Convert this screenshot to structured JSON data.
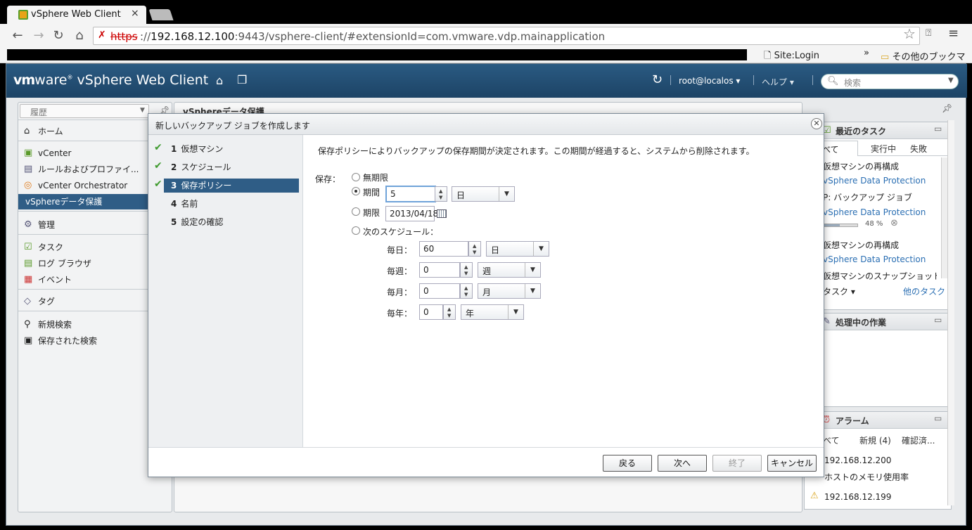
{
  "browser": {
    "tab_title": "vSphere Web Client",
    "tab_close": "×",
    "url_scheme": "https",
    "url_sep": "://",
    "url_host": "192.168.12.100",
    "url_path": ":9443/vsphere-client/#extensionId=com.vmware.vdp.mainapplication",
    "bookmarks": {
      "login": "Site:Login",
      "more": "»",
      "other": "その他のブックマーク"
    }
  },
  "app": {
    "brand_vm": "vm",
    "brand_ware": "ware",
    "brand_product": " vSphere Web Client",
    "user": "root@localos ▾",
    "help": "ヘルプ ▾",
    "search_placeholder": "検索"
  },
  "nav": {
    "history": "履歴",
    "items": {
      "home": "ホーム",
      "vcenter": "vCenter",
      "rules": "ルールおよびプロファイ...",
      "orchestrator": "vCenter Orchestrator",
      "vdp": "vSphereデータ保護",
      "admin": "管理",
      "tasks": "タスク",
      "log": "ログ ブラウザ",
      "events": "イベント",
      "tags": "タグ",
      "new_search": "新規検索",
      "saved_search": "保存された検索"
    }
  },
  "center": {
    "title": "vSphereデータ保護"
  },
  "right": {
    "recent_tasks": "最近のタスク",
    "tabs": {
      "all": "べて",
      "running": "実行中",
      "failed": "失敗"
    },
    "tasks": [
      {
        "name": "仮想マシンの再構成",
        "target": "vSphere Data Protection"
      },
      {
        "name": "P: バックアップ ジョブ",
        "target": "vSphere Data Protection"
      },
      {
        "name": "仮想マシンの再構成",
        "target": "vSphere Data Protection"
      },
      {
        "name": "仮想マシンのスナップショットの作"
      }
    ],
    "progress_pct": "48 %",
    "progress_value": 48,
    "my_tasks": "タスク ▾",
    "more_tasks": "他のタスク",
    "work_in_progress": "処理中の作業",
    "alarms": "アラーム",
    "alarm_tabs": {
      "all": "べて",
      "new": "新規 (4)",
      "ack": "確認済..."
    },
    "alarm_items": [
      {
        "host": "192.168.12.200",
        "desc": "ホストのメモリ使用率"
      },
      {
        "host": "192.168.12.199"
      }
    ]
  },
  "dialog": {
    "title": "新しいバックアップ ジョブを作成します",
    "steps": [
      {
        "num": "1",
        "label": "仮想マシン"
      },
      {
        "num": "2",
        "label": "スケジュール"
      },
      {
        "num": "3",
        "label": "保存ポリシー"
      },
      {
        "num": "4",
        "label": "名前"
      },
      {
        "num": "5",
        "label": "設定の確認"
      }
    ],
    "description": "保存ポリシーによりバックアップの保存期間が決定されます。この期間が経過すると、システムから削除されます。",
    "retention_label": "保存：",
    "options": {
      "forever": "無期限",
      "period": "期間",
      "until": "期限",
      "schedule": "次のスケジュール："
    },
    "period_value": "5",
    "period_unit": "日",
    "until_date": "2013/04/18",
    "schedule_rows": [
      {
        "label": "毎日：",
        "value": "60",
        "unit": "日"
      },
      {
        "label": "毎週：",
        "value": "0",
        "unit": "週"
      },
      {
        "label": "毎月：",
        "value": "0",
        "unit": "月"
      },
      {
        "label": "毎年：",
        "value": "0",
        "unit": "年"
      }
    ],
    "buttons": {
      "back": "戻る",
      "next": "次へ",
      "finish": "終了",
      "cancel": "キャンセル"
    }
  }
}
